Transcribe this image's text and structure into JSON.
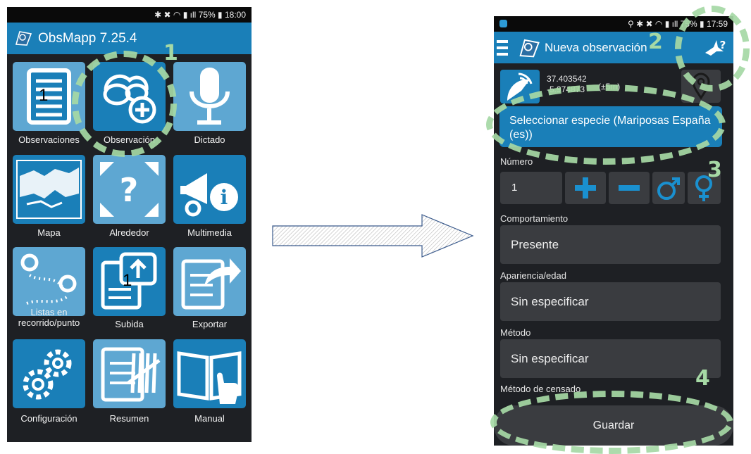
{
  "left_phone": {
    "status": {
      "icons": "bluetooth, mute, wifi, signal",
      "battery": "75%",
      "time": "18:00"
    },
    "app_title": "ObsMapp 7.25.4",
    "tiles": [
      {
        "label": "Observaciones",
        "icon": "notes-icon",
        "badge": "1"
      },
      {
        "label": "Observación",
        "icon": "binoculars-add-icon"
      },
      {
        "label": "Dictado",
        "icon": "microphone-icon"
      },
      {
        "label": "Mapa",
        "icon": "map-icon"
      },
      {
        "label": "Alrededor",
        "icon": "nearby-icon"
      },
      {
        "label": "Multimedia",
        "icon": "megaphone-info-icon"
      },
      {
        "label": "Listas en recorrido/punto",
        "icon": "route-icon"
      },
      {
        "label": "Subida",
        "icon": "upload-icon",
        "badge": "1"
      },
      {
        "label": "Exportar",
        "icon": "export-icon"
      },
      {
        "label": "Configuración",
        "icon": "gears-icon"
      },
      {
        "label": "Resumen",
        "icon": "tally-icon"
      },
      {
        "label": "Manual",
        "icon": "manual-icon"
      }
    ],
    "annotation_number": "1"
  },
  "right_phone": {
    "status": {
      "battery": "75%",
      "time": "17:59"
    },
    "app_title": "Nueva observación",
    "help_icon": "bird-help-icon",
    "gps": {
      "latitude": "37.403542",
      "longitude": "-5.974873",
      "accuracy": "(±5m)"
    },
    "species_button": "Seleccionar especie (Mariposas España (es))",
    "number_label": "Número",
    "number_value": "1",
    "count_buttons": [
      "plus-icon",
      "minus-icon",
      "male-icon",
      "female-icon"
    ],
    "fields": [
      {
        "label": "Comportamiento",
        "value": "Presente"
      },
      {
        "label": "Apariencia/edad",
        "value": "Sin especificar"
      },
      {
        "label": "Método",
        "value": "Sin especificar"
      }
    ],
    "census_label": "Método de censado",
    "save_button": "Guardar",
    "annotation_numbers": [
      "2",
      "3",
      "4"
    ]
  },
  "colors": {
    "accent": "#1a7fb8",
    "tile_light": "#5ea7d2",
    "background": "#1e2024",
    "highlight": "#a6d9a5"
  }
}
